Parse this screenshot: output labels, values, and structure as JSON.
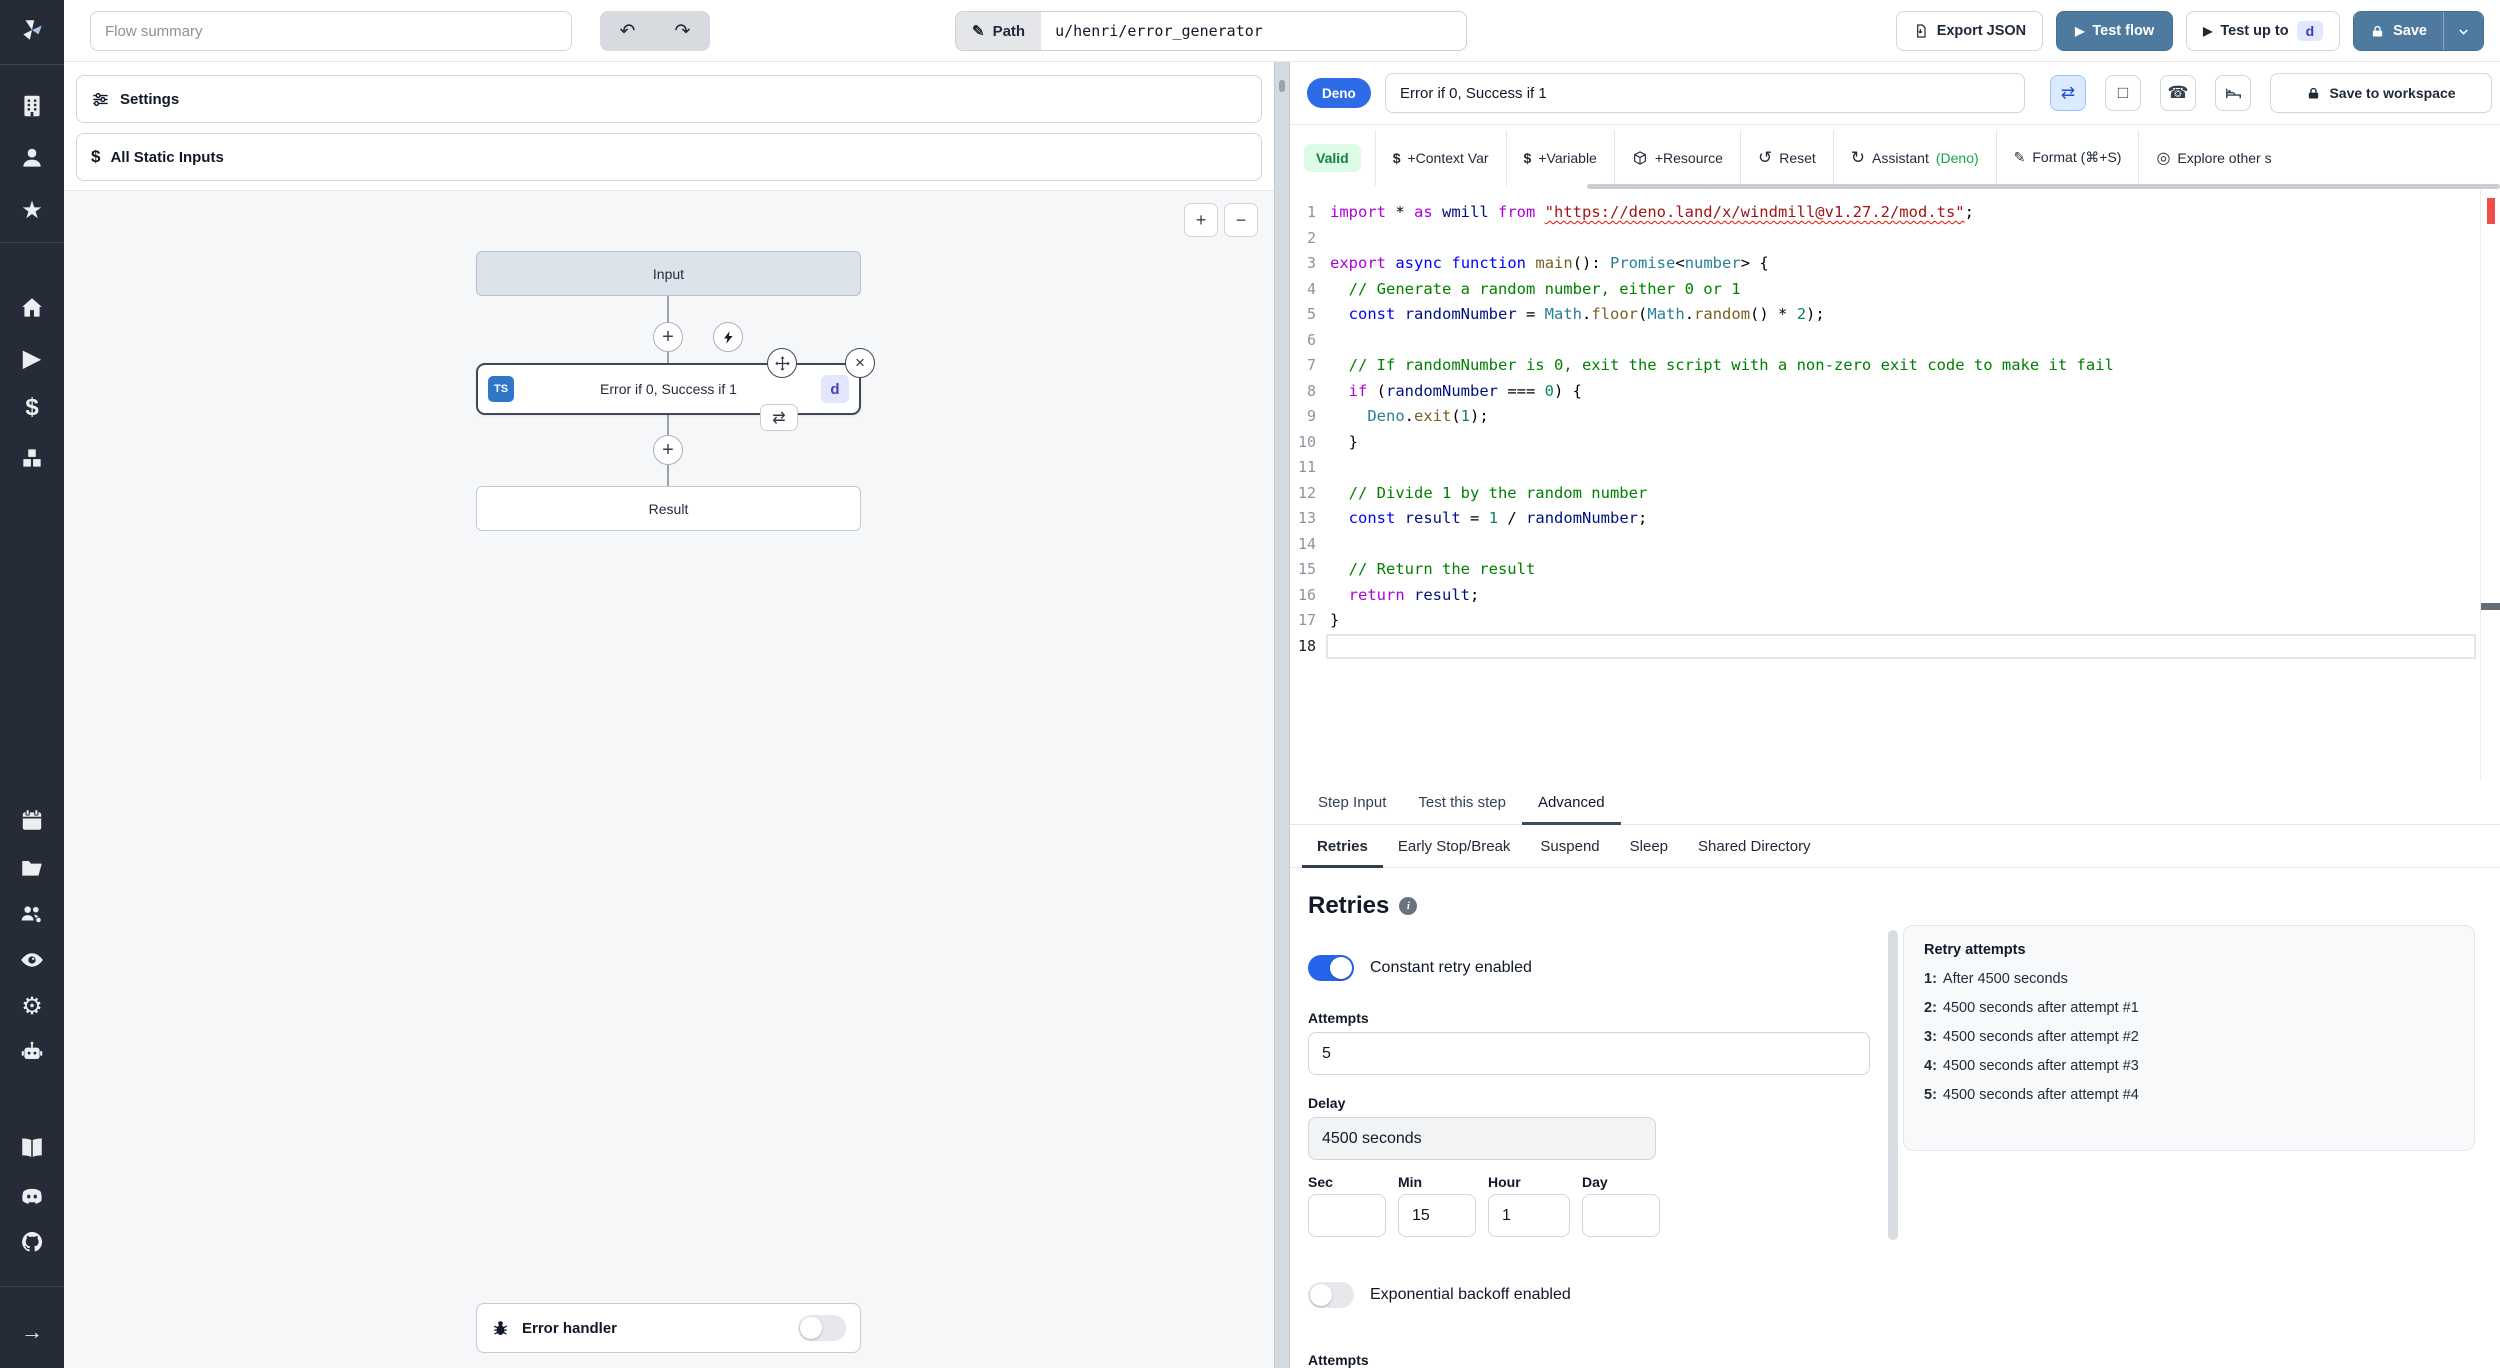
{
  "topbar": {
    "flow_summary_placeholder": "Flow summary",
    "path_label": "Path",
    "path_value": "u/henri/error_generator",
    "export_json": "Export JSON",
    "test_flow": "Test flow",
    "test_up_to": "Test up to",
    "test_up_to_badge": "d",
    "save": "Save"
  },
  "icons": {
    "undo": "↶",
    "redo": "↷",
    "pencil": "✎",
    "play": "▶",
    "zoom_in": "+",
    "zoom_out": "−",
    "plus": "+",
    "close": "×",
    "repeat": "⇄",
    "square": "□",
    "phone": "☎",
    "reset": "↺",
    "assistant": "↻",
    "format_pen": "✎",
    "explore": "◎",
    "dollar": "$",
    "star": "★",
    "gear": "⚙",
    "arrow_right": "→",
    "info": "i"
  },
  "sidebar": {
    "icons": [
      "windmill-logo",
      "building",
      "user",
      "star",
      "home",
      "play",
      "dollar",
      "cubes",
      "calendar",
      "folder",
      "user-group",
      "eye",
      "gear",
      "robot",
      "book",
      "discord",
      "github",
      "arrow-right"
    ]
  },
  "left_panel": {
    "settings": "Settings",
    "all_static_inputs": "All Static Inputs",
    "nodes": {
      "input": "Input",
      "step_title": "Error if 0, Success if 1",
      "step_lang_badge": "TS",
      "step_id_badge": "d",
      "result": "Result",
      "error_handler": "Error handler"
    }
  },
  "step_editor": {
    "lang_badge": "Deno",
    "title_value": "Error if 0, Success if 1",
    "save_to_workspace": "Save to workspace",
    "toolbar": {
      "valid": "Valid",
      "context_var": "+Context Var",
      "variable": "+Variable",
      "resource": "+Resource",
      "reset": "Reset",
      "assistant": "Assistant",
      "assistant_lang": "(Deno)",
      "format": "Format (⌘+S)",
      "explore": "Explore other s"
    },
    "editor": {
      "lines": [
        {
          "n": 1,
          "t": [
            [
              "k",
              "import"
            ],
            [
              "o",
              " * "
            ],
            [
              "k",
              "as"
            ],
            [
              "v",
              " wmill "
            ],
            [
              "k",
              "from"
            ],
            [
              "o",
              " "
            ],
            [
              "ssq",
              "\"https://deno.land/x/windmill@v1.27.2/mod.ts\""
            ],
            [
              "o",
              ";"
            ]
          ]
        },
        {
          "n": 2,
          "t": []
        },
        {
          "n": 3,
          "t": [
            [
              "k",
              "export"
            ],
            [
              "o",
              " "
            ],
            [
              "kb",
              "async"
            ],
            [
              "o",
              " "
            ],
            [
              "kb",
              "function"
            ],
            [
              "o",
              " "
            ],
            [
              "fn",
              "main"
            ],
            [
              "o",
              "(): "
            ],
            [
              "ty",
              "Promise"
            ],
            [
              "o",
              "<"
            ],
            [
              "ty",
              "number"
            ],
            [
              "o",
              "> {"
            ]
          ]
        },
        {
          "n": 4,
          "t": [
            [
              "c",
              "  // Generate a random number, either 0 or 1"
            ]
          ]
        },
        {
          "n": 5,
          "t": [
            [
              "o",
              "  "
            ],
            [
              "kb",
              "const"
            ],
            [
              "o",
              " "
            ],
            [
              "v",
              "randomNumber"
            ],
            [
              "o",
              " = "
            ],
            [
              "ty",
              "Math"
            ],
            [
              "o",
              "."
            ],
            [
              "fn",
              "floor"
            ],
            [
              "o",
              "("
            ],
            [
              "ty",
              "Math"
            ],
            [
              "o",
              "."
            ],
            [
              "fn",
              "random"
            ],
            [
              "o",
              "() * "
            ],
            [
              "n2",
              "2"
            ],
            [
              "o",
              ");"
            ]
          ]
        },
        {
          "n": 6,
          "t": []
        },
        {
          "n": 7,
          "t": [
            [
              "c",
              "  // If randomNumber is 0, exit the script with a non-zero exit code to make it fail"
            ]
          ]
        },
        {
          "n": 8,
          "t": [
            [
              "o",
              "  "
            ],
            [
              "k",
              "if"
            ],
            [
              "o",
              " ("
            ],
            [
              "v",
              "randomNumber"
            ],
            [
              "o",
              " === "
            ],
            [
              "n2",
              "0"
            ],
            [
              "o",
              ") {"
            ]
          ]
        },
        {
          "n": 9,
          "t": [
            [
              "o",
              "    "
            ],
            [
              "ty",
              "Deno"
            ],
            [
              "o",
              "."
            ],
            [
              "fn",
              "exit"
            ],
            [
              "o",
              "("
            ],
            [
              "n2",
              "1"
            ],
            [
              "o",
              ");"
            ]
          ]
        },
        {
          "n": 10,
          "t": [
            [
              "o",
              "  }"
            ]
          ]
        },
        {
          "n": 11,
          "t": []
        },
        {
          "n": 12,
          "t": [
            [
              "c",
              "  // Divide 1 by the random number"
            ]
          ]
        },
        {
          "n": 13,
          "t": [
            [
              "o",
              "  "
            ],
            [
              "kb",
              "const"
            ],
            [
              "o",
              " "
            ],
            [
              "v",
              "result"
            ],
            [
              "o",
              " = "
            ],
            [
              "n2",
              "1"
            ],
            [
              "o",
              " / "
            ],
            [
              "v",
              "randomNumber"
            ],
            [
              "o",
              ";"
            ]
          ]
        },
        {
          "n": 14,
          "t": []
        },
        {
          "n": 15,
          "t": [
            [
              "c",
              "  // Return the result"
            ]
          ]
        },
        {
          "n": 16,
          "t": [
            [
              "o",
              "  "
            ],
            [
              "k",
              "return"
            ],
            [
              "o",
              " "
            ],
            [
              "v",
              "result"
            ],
            [
              "o",
              ";"
            ]
          ]
        },
        {
          "n": 17,
          "t": [
            [
              "o",
              "}"
            ]
          ]
        },
        {
          "n": 18,
          "t": [],
          "cur": true
        }
      ]
    }
  },
  "tabs": {
    "step_input": "Step Input",
    "test_this_step": "Test this step",
    "advanced": "Advanced"
  },
  "subtabs": {
    "retries": "Retries",
    "early_stop": "Early Stop/Break",
    "suspend": "Suspend",
    "sleep": "Sleep",
    "shared_directory": "Shared Directory"
  },
  "retries": {
    "heading": "Retries",
    "constant_retry_label": "Constant retry enabled",
    "attempts_label": "Attempts",
    "attempts_value": "5",
    "delay_label": "Delay",
    "delay_value": "4500 seconds",
    "sec_label": "Sec",
    "min_label": "Min",
    "hour_label": "Hour",
    "day_label": "Day",
    "sec_value": "",
    "min_value": "15",
    "hour_value": "1",
    "day_value": "",
    "exponential_label": "Exponential backoff enabled",
    "clipped_label": "Attempts"
  },
  "retry_info": {
    "title": "Retry attempts",
    "items": [
      {
        "n": "1:",
        "text": "After 4500 seconds"
      },
      {
        "n": "2:",
        "text": "4500 seconds after attempt #1"
      },
      {
        "n": "3:",
        "text": "4500 seconds after attempt #2"
      },
      {
        "n": "4:",
        "text": "4500 seconds after attempt #3"
      },
      {
        "n": "5:",
        "text": "4500 seconds after attempt #4"
      }
    ]
  },
  "colors": {
    "sidebar_bg": "#252c38",
    "steel_button": "#4d7a9e",
    "deno_badge": "#2e6be6",
    "valid_bg": "#dcfce7",
    "valid_text": "#15803d",
    "toggle_on": "#2563eb",
    "ts_badge": "#3076c9",
    "canvas_bg": "#f6f7f9",
    "error_marker": "#f14c4c"
  }
}
